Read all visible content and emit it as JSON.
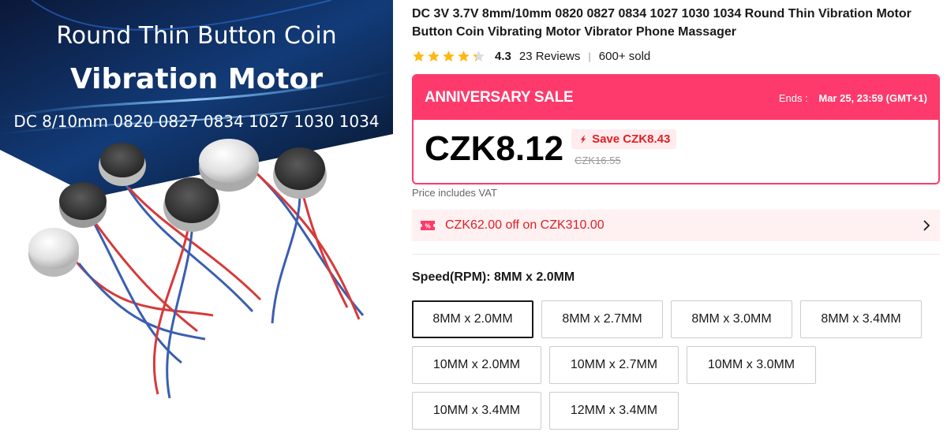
{
  "image": {
    "line1": "Round Thin Button Coin",
    "line2": "Vibration Motor",
    "line3": "DC 8/10mm 0820 0827 0834 1027 1030 1034"
  },
  "product": {
    "title": "DC 3V 3.7V 8mm/10mm 0820 0827 0834 1027 1030 1034 Round Thin Vibration Motor Button Coin Vibrating Motor Vibrator Phone Massager",
    "rating_value": "4.3",
    "rating_stars": 4.3,
    "reviews": "23 Reviews",
    "separator": "|",
    "sold": "600+ sold"
  },
  "sale": {
    "title": "ANNIVERSARY SALE",
    "ends_label": "Ends :",
    "ends_time": "Mar 25, 23:59 (GMT+1)",
    "current_price": "CZK8.12",
    "save_label": "Save CZK8.43",
    "original_price": "CZK16.55",
    "accent_color": "#fd3a6b"
  },
  "vat_note": "Price includes VAT",
  "coupon": {
    "text": "CZK62.00 off on CZK310.00"
  },
  "spec": {
    "label": "Speed(RPM): 8MM x 2.0MM",
    "options": [
      "8MM x 2.0MM",
      "8MM x 2.7MM",
      "8MM x 3.0MM",
      "8MM x 3.4MM",
      "10MM x 2.0MM",
      "10MM x 2.7MM",
      "10MM x 3.0MM",
      "10MM x 3.4MM",
      "12MM x 3.4MM"
    ],
    "selected": "8MM x 2.0MM"
  }
}
